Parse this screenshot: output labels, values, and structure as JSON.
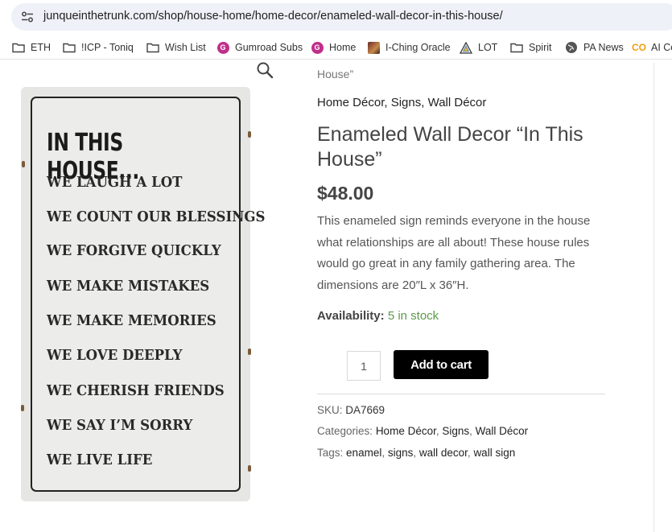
{
  "browser": {
    "url": "junqueinthetrunk.com/shop/house-home/home-decor/enameled-wall-decor-in-this-house/",
    "bookmarks": [
      {
        "label": "ETH",
        "icon": "folder-icon"
      },
      {
        "label": "!ICP - Toniq",
        "icon": "folder-icon"
      },
      {
        "label": "Wish List",
        "icon": "folder-icon"
      },
      {
        "label": "Gumroad Subs",
        "icon": "gumroad-icon"
      },
      {
        "label": "Home",
        "icon": "gumroad-icon"
      },
      {
        "label": "I-Ching Oracle",
        "icon": "iching-icon"
      },
      {
        "label": "LOT",
        "icon": "triangle-logo-icon"
      },
      {
        "label": "Spirit",
        "icon": "folder-icon"
      },
      {
        "label": "PA News",
        "icon": "globe-icon"
      },
      {
        "label": "AI Co",
        "icon": "co-logo-icon"
      }
    ]
  },
  "product": {
    "breadcrumb_tail": "House”",
    "categories_top": [
      "Home Décor",
      "Signs",
      "Wall Décor"
    ],
    "title": "Enameled Wall Decor “In This House”",
    "price": "$48.00",
    "description": "This enameled sign reminds everyone in the house what relationships are all about! These house rules would go great in any family gathering area. The dimensions are 20″L x 36″H.",
    "availability_label": "Availability:",
    "availability_value": "5 in stock",
    "quantity": "1",
    "add_to_cart": "Add to cart",
    "sku_label": "SKU:",
    "sku": "DA7669",
    "categories_label": "Categories:",
    "categories": [
      "Home Décor",
      "Signs",
      "Wall Décor"
    ],
    "tags_label": "Tags:",
    "tags": [
      "enamel",
      "signs",
      "wall decor",
      "wall sign"
    ]
  },
  "sign_image": {
    "heading": "IN THIS HOUSE...",
    "lines": [
      "WE LAUGH A LOT",
      "WE COUNT OUR BLESSINGS",
      "WE FORGIVE QUICKLY",
      "WE MAKE MISTAKES",
      "WE MAKE MEMORIES",
      "WE LOVE DEEPLY",
      "WE CHERISH FRIENDS",
      "WE SAY I’M SORRY",
      "WE LIVE LIFE"
    ]
  },
  "colors": {
    "in_stock": "#5c9a4b",
    "cart_button": "#000000",
    "url_pill": "#eef1f8"
  }
}
